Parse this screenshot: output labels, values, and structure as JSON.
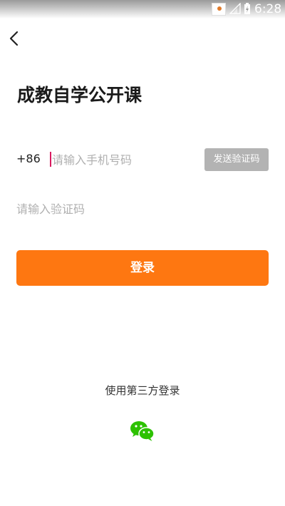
{
  "status_bar": {
    "time": "6:28",
    "icons": [
      "notification-icon",
      "signal-icon",
      "battery-charging-icon"
    ]
  },
  "header": {
    "back_icon": "chevron-left-icon"
  },
  "title": "成教自学公开课",
  "phone": {
    "country_code": "+86",
    "placeholder": "请输入手机号码",
    "value": ""
  },
  "send_code": {
    "label": "发送验证码",
    "color": "#b3b3b3"
  },
  "verification": {
    "placeholder": "请输入验证码",
    "value": ""
  },
  "login": {
    "label": "登录",
    "color": "#fe7711"
  },
  "third_party": {
    "label": "使用第三方登录",
    "providers": [
      {
        "icon": "wechat-icon",
        "color": "#2dc100"
      }
    ]
  }
}
